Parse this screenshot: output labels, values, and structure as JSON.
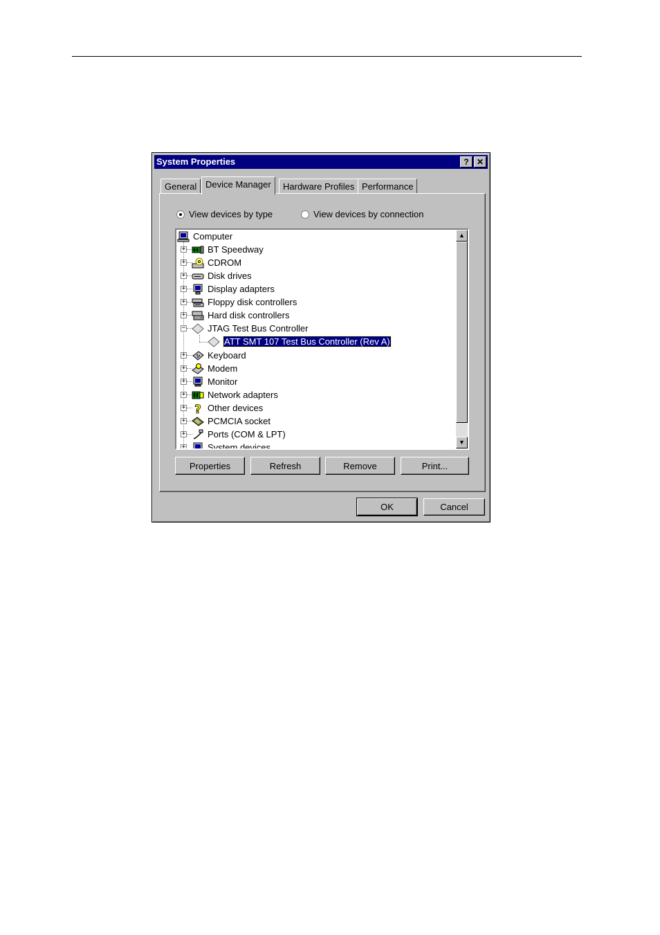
{
  "window": {
    "title": "System Properties",
    "help_glyph": "?",
    "close_glyph": "✕"
  },
  "tabs": [
    {
      "label": "General",
      "active": false
    },
    {
      "label": "Device Manager",
      "active": true
    },
    {
      "label": "Hardware Profiles",
      "active": false
    },
    {
      "label": "Performance",
      "active": false
    }
  ],
  "view_options": {
    "by_type": {
      "label": "View devices by type",
      "selected": true
    },
    "by_connection": {
      "label": "View devices by connection",
      "selected": false
    }
  },
  "tree": {
    "root": {
      "label": "Computer",
      "icon": "computer-icon"
    },
    "items": [
      {
        "label": "BT Speedway",
        "icon": "network-card-icon",
        "expander": "+"
      },
      {
        "label": "CDROM",
        "icon": "cdrom-icon",
        "expander": "+"
      },
      {
        "label": "Disk drives",
        "icon": "disk-drive-icon",
        "expander": "+"
      },
      {
        "label": "Display adapters",
        "icon": "display-adapter-icon",
        "expander": "+"
      },
      {
        "label": "Floppy disk controllers",
        "icon": "floppy-controller-icon",
        "expander": "+"
      },
      {
        "label": "Hard disk controllers",
        "icon": "hard-disk-controller-icon",
        "expander": "+"
      },
      {
        "label": "JTAG Test Bus Controller",
        "icon": "jtag-diamond-icon",
        "expander": "−"
      },
      {
        "label": "ATT SMT 107 Test Bus Controller (Rev A)",
        "icon": "jtag-diamond-icon",
        "child": true,
        "selected": true
      },
      {
        "label": "Keyboard",
        "icon": "keyboard-icon",
        "expander": "+"
      },
      {
        "label": "Modem",
        "icon": "modem-icon",
        "expander": "+"
      },
      {
        "label": "Monitor",
        "icon": "monitor-icon",
        "expander": "+"
      },
      {
        "label": "Network adapters",
        "icon": "network-adapter-icon",
        "expander": "+"
      },
      {
        "label": "Other devices",
        "icon": "question-icon",
        "expander": "+"
      },
      {
        "label": "PCMCIA socket",
        "icon": "pcmcia-icon",
        "expander": "+"
      },
      {
        "label": "Ports (COM & LPT)",
        "icon": "port-icon",
        "expander": "+"
      },
      {
        "label": "System devices",
        "icon": "system-devices-icon",
        "expander": "+"
      }
    ]
  },
  "buttons": {
    "properties": "Properties",
    "refresh": "Refresh",
    "remove": "Remove",
    "print": "Print...",
    "ok": "OK",
    "cancel": "Cancel"
  },
  "colors": {
    "titlebar": "#000080",
    "face": "#c0c0c0",
    "selection": "#000080"
  }
}
